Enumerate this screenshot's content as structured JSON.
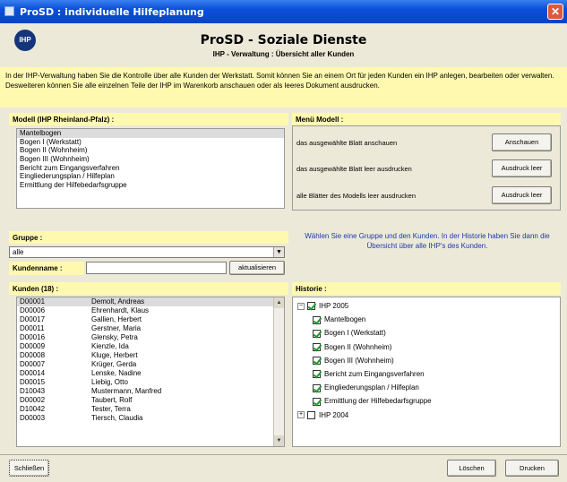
{
  "window": {
    "title": "ProSD : individuelle Hilfeplanung",
    "close_glyph": "✕"
  },
  "header": {
    "logo_text": "IHP",
    "title": "ProSD - Soziale Dienste",
    "subtitle": "IHP - Verwaltung : Übersicht aller Kunden"
  },
  "intro": {
    "text": "In der IHP-Verwaltung haben Sie die Kontrolle über alle Kunden der Werkstatt. Somit können Sie an einem Ort für jeden Kunden ein IHP anlegen, bearbeiten oder verwalten. Desweiteren können Sie alle einzelnen Teile der IHP im Warenkorb anschauen oder als leeres Dokument ausdrucken."
  },
  "modell": {
    "heading": "Modell (IHP Rheinland-Pfalz) :",
    "items": [
      "Mantelbogen",
      "Bogen I (Werkstatt)",
      "Bogen II (Wohnheim)",
      "Bogen III (Wohnheim)",
      "Bericht zum Eingangsverfahren",
      "Eingliederungsplan / Hilfeplan",
      "Ermittlung der Hilfebedarfsgruppe"
    ],
    "selected_index": 0
  },
  "menu": {
    "heading": "Menü Modell :",
    "rows": [
      {
        "label": "das ausgewählte Blatt anschauen",
        "button": "Anschauen"
      },
      {
        "label": "das ausgewählte Blatt leer ausdrucken",
        "button": "Ausdruck leer"
      },
      {
        "label": "alle Blätter des Modells leer ausdrucken",
        "button": "Ausdruck leer"
      }
    ]
  },
  "gruppe": {
    "heading": "Gruppe :",
    "value": "alle",
    "arrow": "▼"
  },
  "hint": "Wählen Sie eine Gruppe und den Kunden. In der Historie haben Sie dann die Übersicht über alle IHP's des Kunden.",
  "kundenname": {
    "label": "Kundenname :",
    "value": "",
    "button": "aktualisieren"
  },
  "kunden": {
    "heading": "Kunden (18) :",
    "rows": [
      {
        "id": "D00001",
        "name": "Demolt, Andreas"
      },
      {
        "id": "D00006",
        "name": "Ehrenhardt, Klaus"
      },
      {
        "id": "D00017",
        "name": "Gallien, Herbert"
      },
      {
        "id": "D00011",
        "name": "Gerstner, Maria"
      },
      {
        "id": "D00016",
        "name": "Glensky, Petra"
      },
      {
        "id": "D00009",
        "name": "Kienzle, Ida"
      },
      {
        "id": "D00008",
        "name": "Kluge, Herbert"
      },
      {
        "id": "D00007",
        "name": "Krüger, Gerda"
      },
      {
        "id": "D00014",
        "name": "Lenske, Nadine"
      },
      {
        "id": "D00015",
        "name": "Liebig, Otto"
      },
      {
        "id": "D10043",
        "name": "Mustermann, Manfred"
      },
      {
        "id": "D00002",
        "name": "Taubert, Rolf"
      },
      {
        "id": "D10042",
        "name": "Tester, Terra"
      },
      {
        "id": "D00003",
        "name": "Tiersch, Claudia"
      }
    ],
    "selected_index": 0,
    "scroll_up": "▲",
    "scroll_down": "▼"
  },
  "historie": {
    "heading": "Historie :",
    "nodes": [
      {
        "label": "IHP 2005",
        "level": 0,
        "checked": true,
        "expander": "−"
      },
      {
        "label": "Mantelbogen",
        "level": 1,
        "checked": true
      },
      {
        "label": "Bogen I (Werkstatt)",
        "level": 1,
        "checked": true
      },
      {
        "label": "Bogen II (Wohnheim)",
        "level": 1,
        "checked": true
      },
      {
        "label": "Bogen III (Wohnheim)",
        "level": 1,
        "checked": true
      },
      {
        "label": "Bericht zum Eingangsverfahren",
        "level": 1,
        "checked": true
      },
      {
        "label": "Eingliederungsplan / Hilfeplan",
        "level": 1,
        "checked": true
      },
      {
        "label": "Ermittlung der Hilfebedarfsgruppe",
        "level": 1,
        "checked": true
      },
      {
        "label": "IHP 2004",
        "level": 0,
        "checked": false,
        "expander": "+"
      }
    ]
  },
  "footer": {
    "close_button": "Schließen",
    "delete_button": "Löschen",
    "print_button": "Drucken"
  }
}
